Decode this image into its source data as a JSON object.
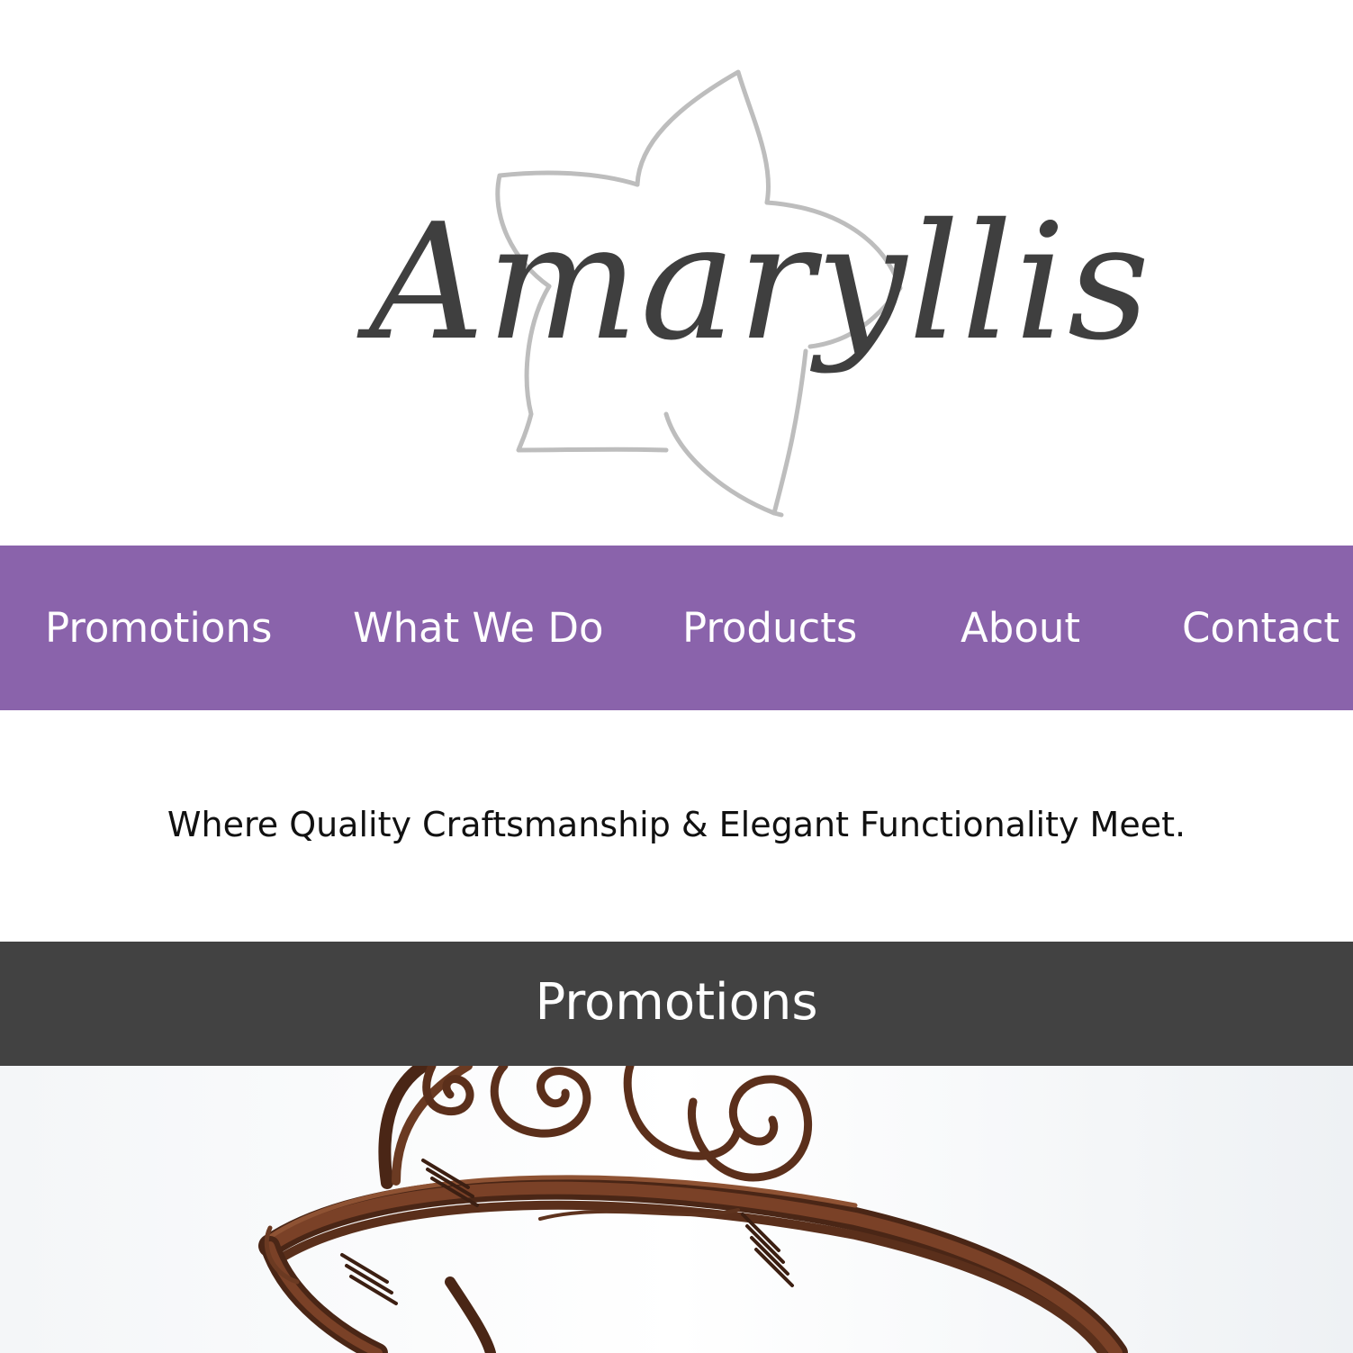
{
  "brand": {
    "logo_text": "Amaryllis",
    "logo_icon": "amaryllis-flower-outline"
  },
  "colors": {
    "nav_background": "#8a63ab",
    "section_bar_background": "#424242",
    "logo_text": "#3f3f3f",
    "flower_outline": "#bdbdbd",
    "copper": "#6b3a22"
  },
  "nav": {
    "items": [
      {
        "label": "Promotions"
      },
      {
        "label": "What We Do"
      },
      {
        "label": "Products"
      },
      {
        "label": "About"
      },
      {
        "label": "Contact"
      }
    ]
  },
  "tagline": "Where Quality Craftsmanship & Elegant Functionality Meet.",
  "section": {
    "title": "Promotions"
  },
  "promo_image": {
    "subject": "copper-wire-spiral-cuff-bracelet"
  }
}
